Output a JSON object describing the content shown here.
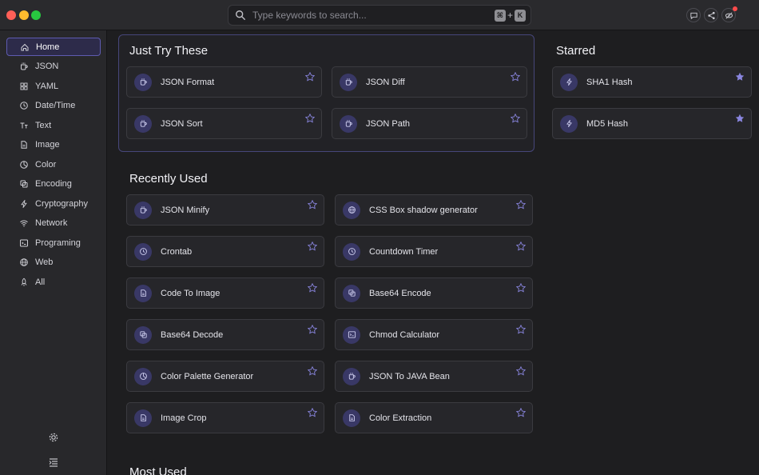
{
  "search": {
    "placeholder": "Type keywords to search...",
    "kbd_cmd": "⌘",
    "kbd_plus": "+",
    "kbd_key": "K"
  },
  "sidebar": {
    "items": [
      {
        "label": "Home",
        "icon": "home-icon",
        "active": true
      },
      {
        "label": "JSON",
        "icon": "mug-icon"
      },
      {
        "label": "YAML",
        "icon": "grid-icon"
      },
      {
        "label": "Date/Time",
        "icon": "clock-icon"
      },
      {
        "label": "Text",
        "icon": "text-icon"
      },
      {
        "label": "Image",
        "icon": "file-icon"
      },
      {
        "label": "Color",
        "icon": "palette-icon"
      },
      {
        "label": "Encoding",
        "icon": "copy-icon"
      },
      {
        "label": "Cryptography",
        "icon": "bolt-icon"
      },
      {
        "label": "Network",
        "icon": "wifi-icon"
      },
      {
        "label": "Programing",
        "icon": "terminal-icon"
      },
      {
        "label": "Web",
        "icon": "globe-icon"
      },
      {
        "label": "All",
        "icon": "rocket-icon"
      }
    ]
  },
  "sections": {
    "just_try": {
      "title": "Just Try These",
      "cards": [
        {
          "label": "JSON Format",
          "icon": "mug-icon"
        },
        {
          "label": "JSON Diff",
          "icon": "mug-icon"
        },
        {
          "label": "JSON Sort",
          "icon": "mug-icon"
        },
        {
          "label": "JSON Path",
          "icon": "mug-icon"
        }
      ]
    },
    "starred": {
      "title": "Starred",
      "cards": [
        {
          "label": "SHA1 Hash",
          "icon": "bolt-icon"
        },
        {
          "label": "MD5 Hash",
          "icon": "bolt-icon"
        }
      ]
    },
    "recent": {
      "title": "Recently Used",
      "cards": [
        {
          "label": "JSON Minify",
          "icon": "mug-icon"
        },
        {
          "label": "CSS Box shadow generator",
          "icon": "globe-icon"
        },
        {
          "label": "Crontab",
          "icon": "clock-icon"
        },
        {
          "label": "Countdown Timer",
          "icon": "clock-icon"
        },
        {
          "label": "Code To Image",
          "icon": "file-icon"
        },
        {
          "label": "Base64 Encode",
          "icon": "copy-icon"
        },
        {
          "label": "Base64 Decode",
          "icon": "copy-icon"
        },
        {
          "label": "Chmod Calculator",
          "icon": "terminal-icon"
        },
        {
          "label": "Color Palette Generator",
          "icon": "palette-icon"
        },
        {
          "label": "JSON To JAVA Bean",
          "icon": "mug-icon"
        },
        {
          "label": "Image Crop",
          "icon": "file-icon"
        },
        {
          "label": "Color Extraction",
          "icon": "file-icon"
        }
      ]
    },
    "most": {
      "title": "Most Used"
    }
  },
  "colors": {
    "accent": "#5e5bb0",
    "icon_bg": "#393866",
    "star_filled": "#8a86e0"
  }
}
